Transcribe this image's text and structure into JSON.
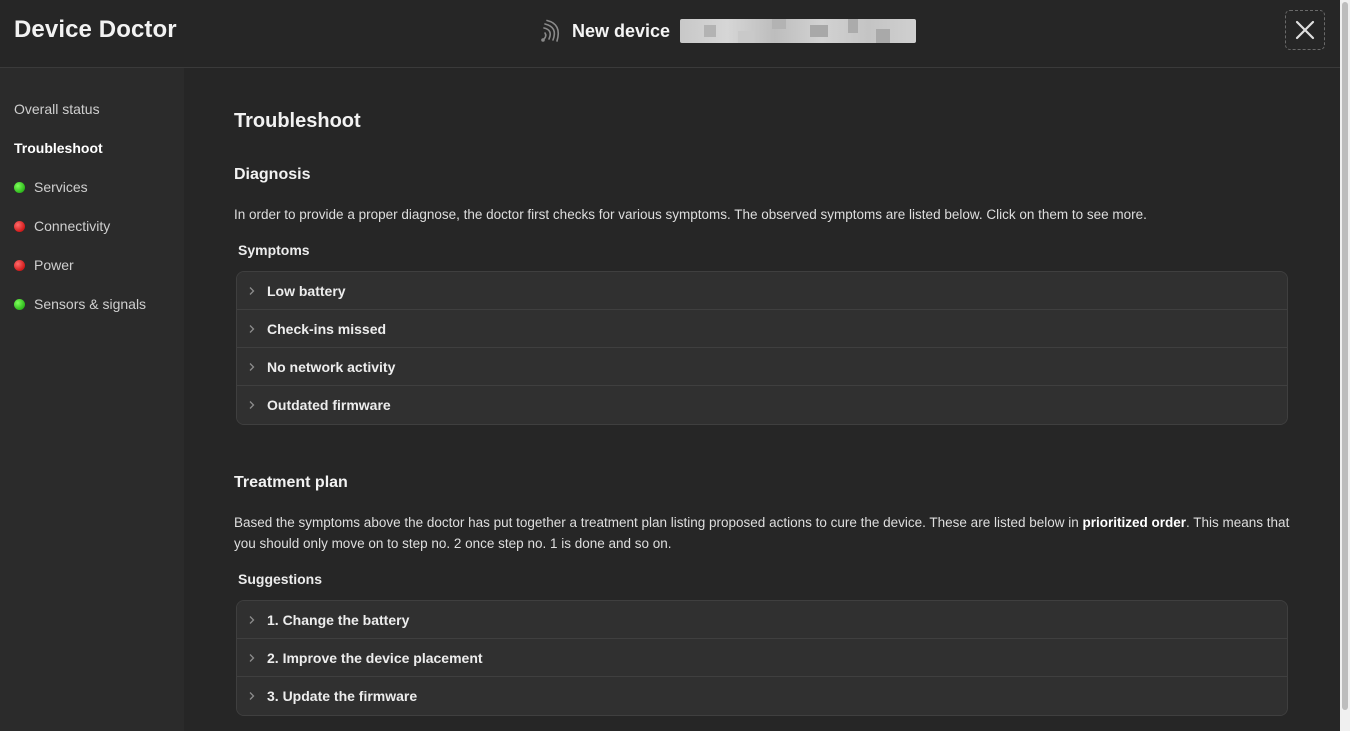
{
  "header": {
    "app_title": "Device Doctor",
    "device_name": "New device",
    "close_icon": "close-icon",
    "signal_icon": "signal-icon"
  },
  "sidebar": {
    "items": [
      {
        "label": "Overall status",
        "status": null,
        "active": false
      },
      {
        "label": "Troubleshoot",
        "status": null,
        "active": true
      },
      {
        "label": "Services",
        "status": "green",
        "active": false
      },
      {
        "label": "Connectivity",
        "status": "red",
        "active": false
      },
      {
        "label": "Power",
        "status": "red",
        "active": false
      },
      {
        "label": "Sensors & signals",
        "status": "green",
        "active": false
      }
    ]
  },
  "main": {
    "title": "Troubleshoot",
    "diagnosis": {
      "title": "Diagnosis",
      "text": "In order to provide a proper diagnose, the doctor first checks for various symptoms. The observed symptoms are listed below. Click on them to see more.",
      "list_title": "Symptoms",
      "items": [
        "Low battery",
        "Check-ins missed",
        "No network activity",
        "Outdated firmware"
      ]
    },
    "treatment": {
      "title": "Treatment plan",
      "text_before": "Based the symptoms above the doctor has put together a treatment plan listing proposed actions to cure the device. These are listed below in ",
      "text_bold": "prioritized order",
      "text_after": ". This means that you should only move on to step no. 2 once step no. 1 is done and so on.",
      "list_title": "Suggestions",
      "items": [
        "1. Change the battery",
        "2. Improve the device placement",
        "3. Update the firmware"
      ]
    }
  },
  "colors": {
    "background": "#262626",
    "sidebar": "#2b2b2b",
    "status_green": "#2eb81c",
    "status_red": "#d11a1a"
  }
}
